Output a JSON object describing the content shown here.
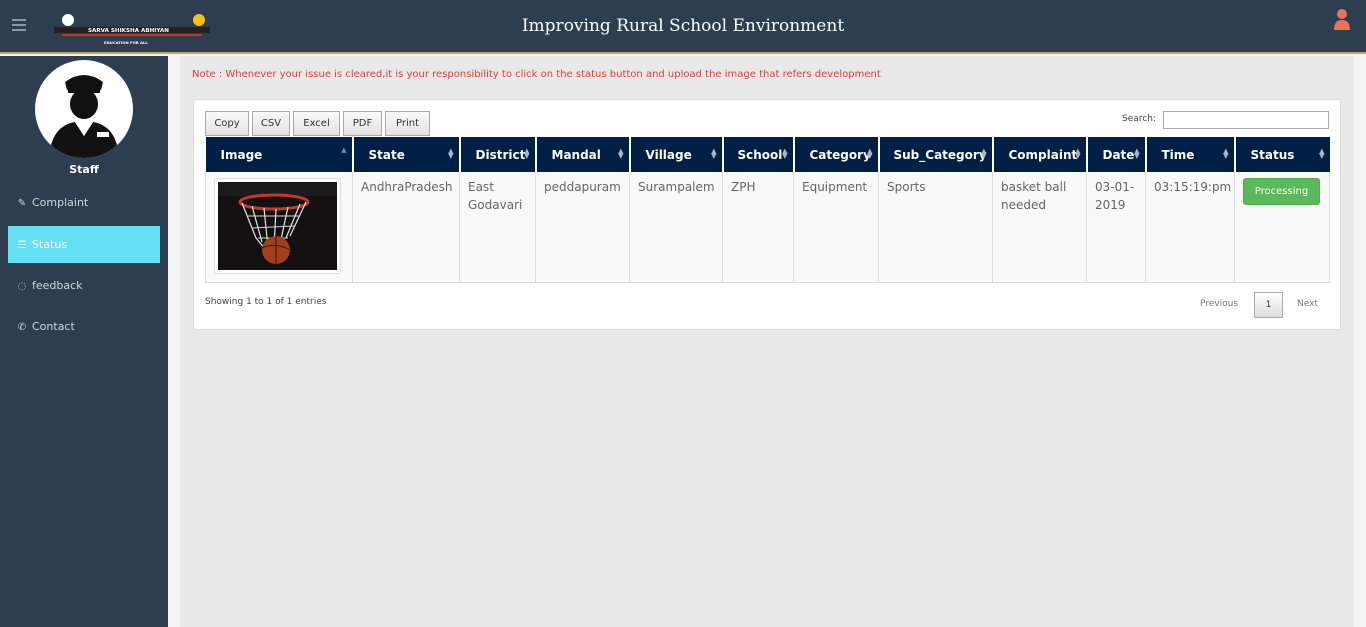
{
  "header": {
    "title": "Improving Rural School Environment",
    "logo_text": "SARVA SHIKSHA ABHIYAN",
    "logo_subtext": "EDUCATION FOR ALL",
    "user_icon": "user-icon",
    "menu_icon": "hamburger-icon"
  },
  "sidebar": {
    "staff_label": "Staff",
    "items": [
      {
        "label": "Complaint",
        "icon": "edit-icon"
      },
      {
        "label": "Status",
        "icon": "list-icon"
      },
      {
        "label": "feedback",
        "icon": "comment-icon"
      },
      {
        "label": "Contact",
        "icon": "phone-icon"
      }
    ]
  },
  "note": "Note : Whenever your issue is cleared,it is your responsibility to click on the status button and upload the image that refers development",
  "toolbar": {
    "copy": "Copy",
    "csv": "CSV",
    "excel": "Excel",
    "pdf": "PDF",
    "print": "Print"
  },
  "search": {
    "label": "Search:",
    "value": ""
  },
  "table": {
    "columns": [
      "Image",
      "State",
      "District",
      "Mandal",
      "Village",
      "School",
      "Category",
      "Sub_Category",
      "Complaint",
      "Date",
      "Time",
      "Status"
    ],
    "rows": [
      {
        "state": "AndhraPradesh",
        "district": "East Godavari",
        "mandal": "peddapuram",
        "village": "Surampalem",
        "school": "ZPH",
        "category": "Equipment",
        "sub_category": "Sports",
        "complaint": "basket ball needed",
        "date": "03-01-2019",
        "time": "03:15:19:pm",
        "status": "Processing"
      }
    ]
  },
  "footer": {
    "info": "Showing 1 to 1 of 1 entries",
    "previous": "Previous",
    "page": "1",
    "next": "Next"
  },
  "colors": {
    "topbar": "#2c3e50",
    "active_nav": "#64e0f4",
    "table_header": "#001f44",
    "status_button": "#5cb85c",
    "note_text": "#e33b3b"
  }
}
